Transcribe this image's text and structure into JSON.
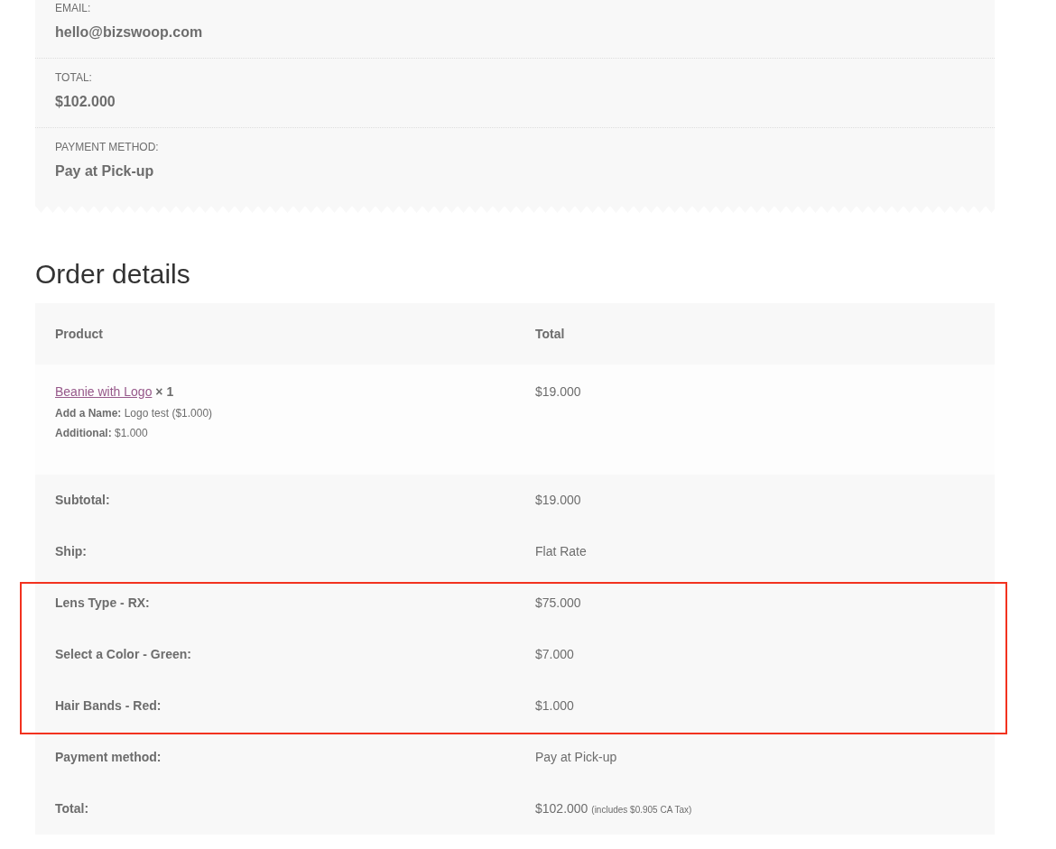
{
  "overview": [
    {
      "label": "EMAIL:",
      "value": "hello@bizswoop.com"
    },
    {
      "label": "TOTAL:",
      "value": "$102.000"
    },
    {
      "label": "PAYMENT METHOD:",
      "value": "Pay at Pick-up"
    }
  ],
  "order_details": {
    "title": "Order details",
    "columns": [
      "Product",
      "Total"
    ],
    "items": [
      {
        "product": "Beanie with Logo",
        "quantity": "× 1",
        "meta": [
          {
            "key": "Add a Name:",
            "value": "Logo test ($1.000)"
          },
          {
            "key": "Additional:",
            "value": "$1.000"
          }
        ],
        "total": "$19.000"
      }
    ],
    "totals": [
      {
        "label": "Subtotal:",
        "value": "$19.000",
        "highlighted": false
      },
      {
        "label": "Ship:",
        "value": "Flat Rate",
        "highlighted": false
      },
      {
        "label": "Lens Type - RX:",
        "value": "$75.000",
        "highlighted": true
      },
      {
        "label": "Select a Color - Green:",
        "value": "$7.000",
        "highlighted": true
      },
      {
        "label": "Hair Bands - Red:",
        "value": "$1.000",
        "highlighted": true
      },
      {
        "label": "Payment method:",
        "value": "Pay at Pick-up",
        "highlighted": false
      },
      {
        "label": "Total:",
        "value": "$102.000",
        "note": "(includes $0.905 CA Tax)",
        "highlighted": false
      }
    ]
  }
}
